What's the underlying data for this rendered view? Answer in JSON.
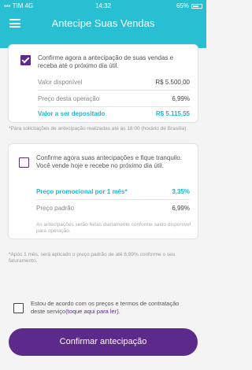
{
  "status_bar": {
    "carrier": "TIM",
    "network": "4G",
    "time": "14:32",
    "battery": "65%"
  },
  "header": {
    "title": "Antecipe Suas Vendas"
  },
  "option1": {
    "checked": true,
    "text": "Confirme agora a antecipação de suas vendas e receba até o próximo dia útil.",
    "rows": [
      {
        "label": "Valor disponível",
        "value": "R$ 5.500,00"
      },
      {
        "label": "Preço desta operação",
        "value": "6,99%"
      },
      {
        "label": "Valor a ser depositado",
        "value": "R$ 5.115,55"
      }
    ]
  },
  "note1": "*Para solicitações de antecipação realizadas até às 18:00 (horário de Brasília).",
  "option2": {
    "checked": false,
    "text": "Confirme agora suas antecipações e fique tranquilo. Você vende hoje e recebe no próximo dia útil.",
    "rows": [
      {
        "label": "Preço promocional por 1 mês*",
        "value": "3,35%"
      },
      {
        "label": "Preço padrão",
        "value": "6,99%"
      }
    ],
    "footer": "As antecipações serão feitas diariamente conforme saldo disponível para operação."
  },
  "note2": "*Após 1 mês, será aplicado o preço padrão de até 6,99% conforme o seu faturamento.",
  "terms": {
    "checked": false,
    "text": "Estou de acordo com os preços e termos de contratação deste serviço",
    "link": "(toque aqui para ler)",
    "end": "."
  },
  "confirm_button": "Confirmar antecipação",
  "colors": {
    "header": "#27bfd1",
    "accent": "#5b2a8a",
    "highlight": "#1fb8c9"
  }
}
